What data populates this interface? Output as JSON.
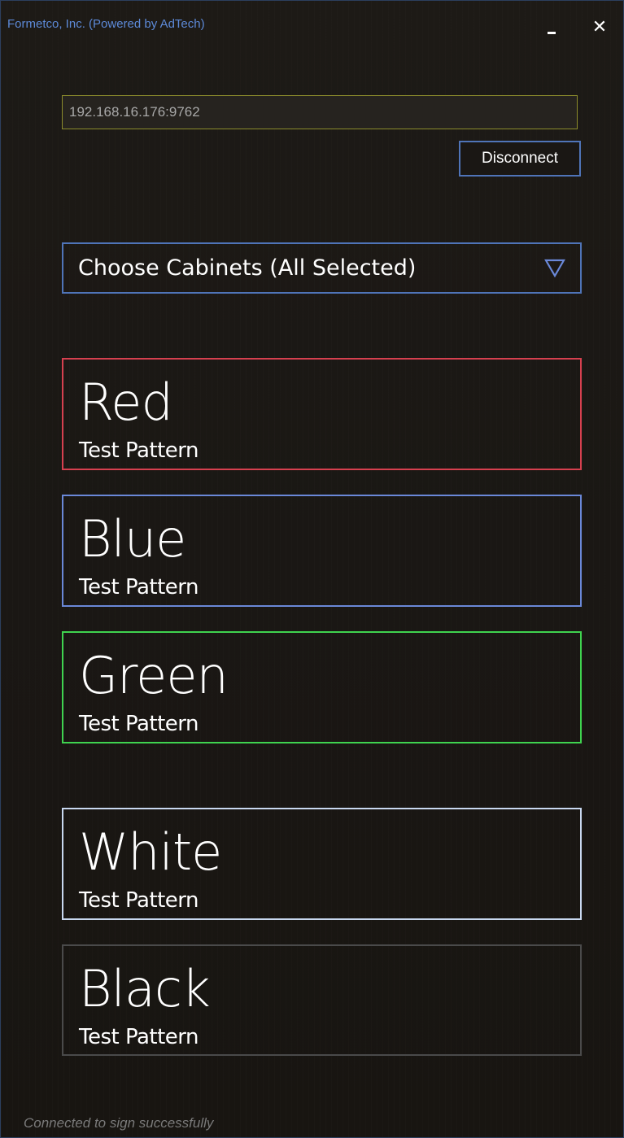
{
  "window": {
    "title": "Formetco, Inc. (Powered by AdTech)",
    "minimize_icon": "minimize-icon",
    "close_icon": "close-icon",
    "close_glyph": "✕"
  },
  "connection": {
    "address_value": "192.168.16.176:9762",
    "disconnect_label": "Disconnect"
  },
  "cabinets": {
    "label": "Choose Cabinets (All Selected)",
    "dropdown_icon": "triangle-down-icon"
  },
  "patterns": [
    {
      "name": "Red",
      "subtitle": "Test Pattern",
      "border_color": "#d6404f"
    },
    {
      "name": "Blue",
      "subtitle": "Test Pattern",
      "border_color": "#6a88d8"
    },
    {
      "name": "Green",
      "subtitle": "Test Pattern",
      "border_color": "#3fd34f"
    },
    {
      "name": "White",
      "subtitle": "Test Pattern",
      "border_color": "#c8d8f0"
    },
    {
      "name": "Black",
      "subtitle": "Test Pattern",
      "border_color": "#4a4a4a"
    }
  ],
  "status": {
    "message": "Connected to sign successfully"
  },
  "colors": {
    "title_text": "#5d8ad8",
    "accent_blue": "#4f74b8",
    "input_border": "#8c8c2c",
    "background": "#1a1714"
  }
}
